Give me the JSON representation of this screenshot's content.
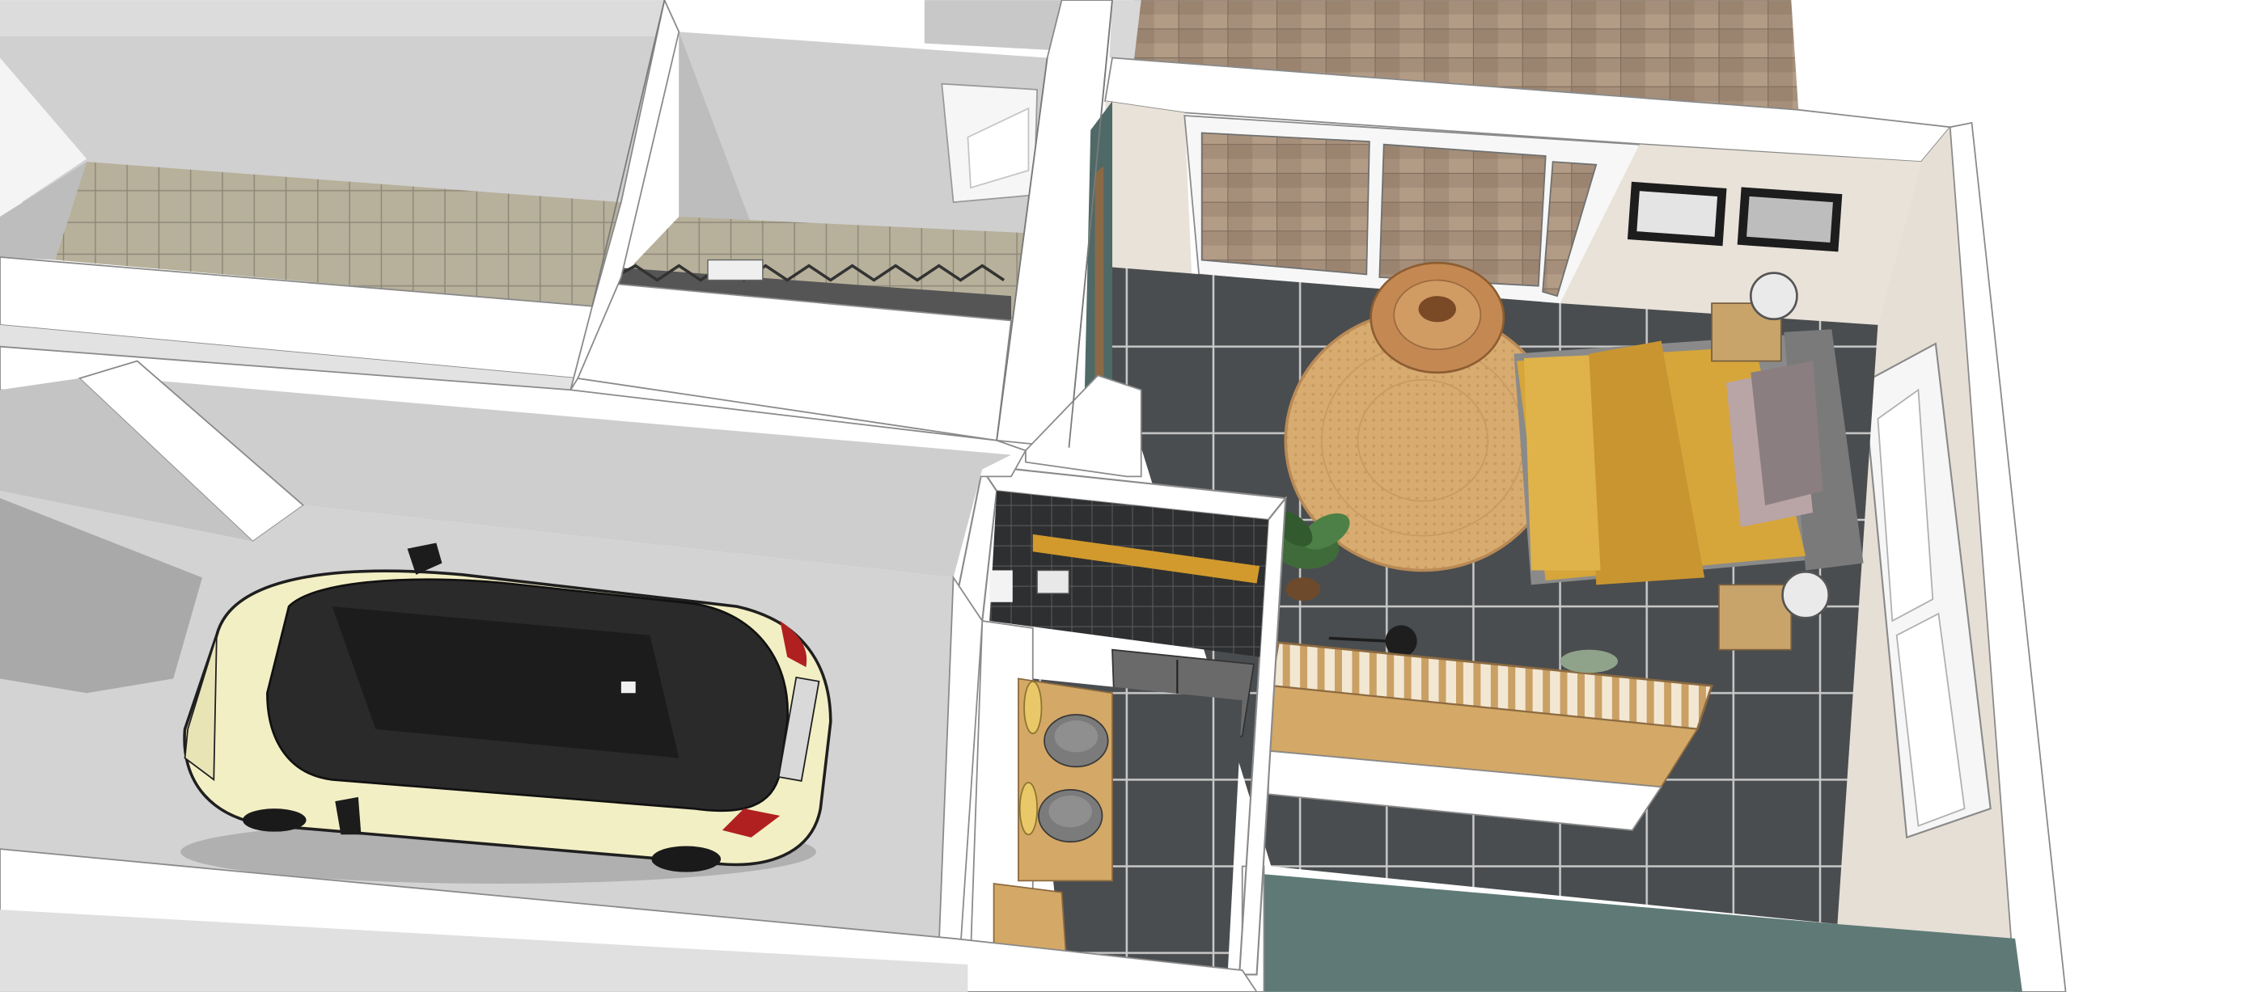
{
  "scene": {
    "kind": "3d-floor-plan-render",
    "rooms": [
      "garage",
      "bedroom",
      "bathroom",
      "upper-rooms",
      "terrace"
    ],
    "colors": {
      "wall": "#ffffff",
      "wall_shadow": "#cfcfcf",
      "floor_dark": "#4a4d4f",
      "floor_light": "#d6d6d6",
      "garage_floor": "#d2d2d2",
      "terrace_tile": "#a89480",
      "upper_tile": "#b9b19c",
      "car_body": "#f3efc4",
      "car_roof": "#262626",
      "bedding": "#d6a63b",
      "rug": "#d9ad72",
      "wood": "#d4a866",
      "bed_frame": "#8a8a8a",
      "wall_green": "#5f7a76",
      "wall_beige": "#e9e2d8"
    },
    "icons": [
      "car-icon",
      "bed-icon",
      "rug-icon",
      "pendant-lamp-icon",
      "plant-icon",
      "sink-icon",
      "picture-frame-icon",
      "window-icon"
    ]
  }
}
